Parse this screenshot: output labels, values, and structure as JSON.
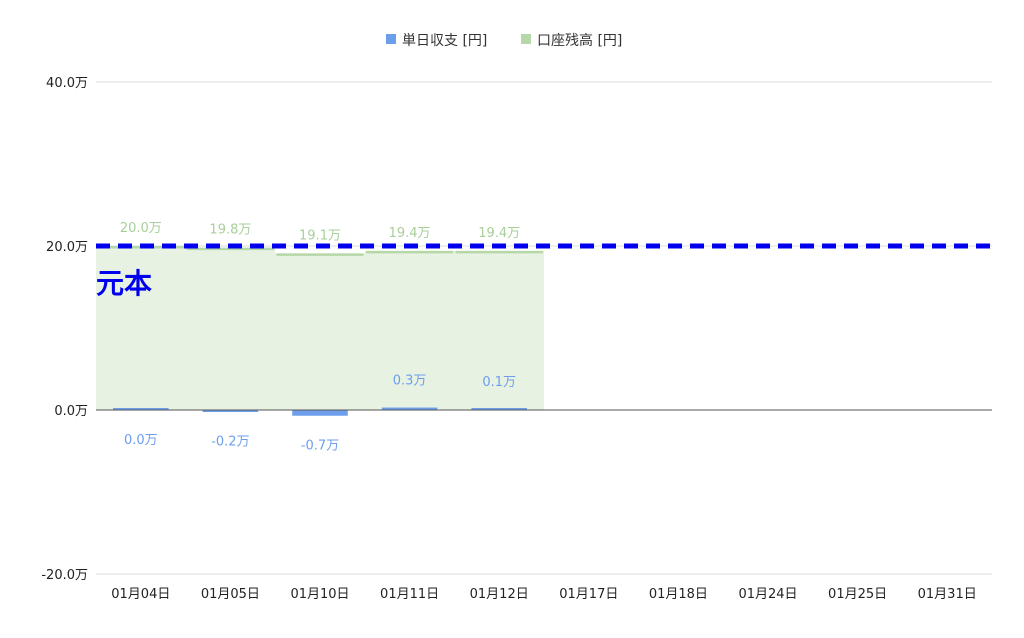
{
  "chart_data": {
    "type": "bar",
    "title": "",
    "xlabel": "",
    "ylabel": "",
    "ylim": [
      -20,
      40
    ],
    "y_ticks": [
      -20,
      0,
      20,
      40
    ],
    "y_tick_labels": [
      "-20.0万",
      "0.0万",
      "20.0万",
      "40.0万"
    ],
    "categories": [
      "01月04日",
      "01月05日",
      "01月10日",
      "01月11日",
      "01月12日",
      "01月17日",
      "01月18日",
      "01月24日",
      "01月25日",
      "01月31日"
    ],
    "series": [
      {
        "name": "単日収支 [円]",
        "kind": "bar",
        "color": "#6d9eeb",
        "values": [
          0.0,
          -0.2,
          -0.7,
          0.3,
          0.1,
          null,
          null,
          null,
          null,
          null
        ],
        "labels": [
          "0.0万",
          "-0.2万",
          "-0.7万",
          "0.3万",
          "0.1万",
          "",
          "",
          "",
          "",
          ""
        ]
      },
      {
        "name": "口座残高 [円]",
        "kind": "stepped-area",
        "color": "#b6d7a8",
        "values": [
          20.0,
          19.8,
          19.1,
          19.4,
          19.4,
          null,
          null,
          null,
          null,
          null
        ],
        "labels": [
          "20.0万",
          "19.8万",
          "19.1万",
          "19.4万",
          "19.4万",
          "",
          "",
          "",
          "",
          ""
        ]
      }
    ],
    "reference_line": {
      "label": "元本",
      "value": 20.0,
      "color": "#0000ee",
      "style": "dashed"
    },
    "legend": {
      "position": "top"
    },
    "grid": true
  }
}
